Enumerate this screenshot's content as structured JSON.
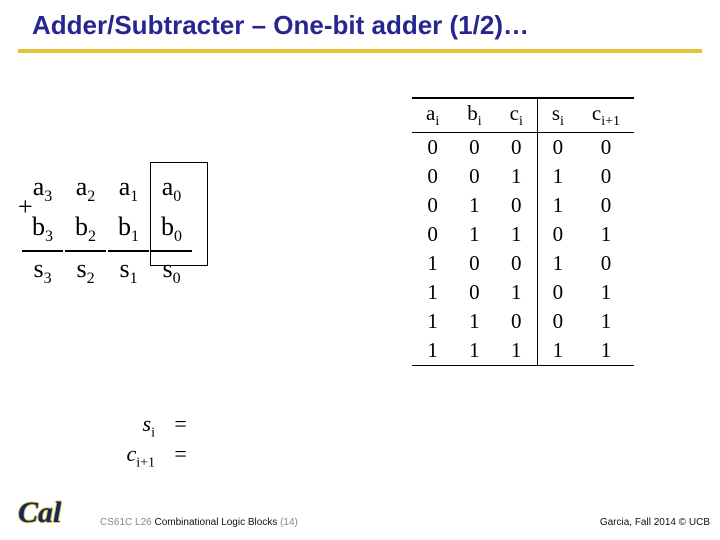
{
  "title": "Adder/Subtracter – One-bit adder (1/2)…",
  "addition": {
    "plus": "+",
    "row_a": [
      {
        "base": "a",
        "sub": "3"
      },
      {
        "base": "a",
        "sub": "2"
      },
      {
        "base": "a",
        "sub": "1"
      },
      {
        "base": "a",
        "sub": "0"
      }
    ],
    "row_b": [
      {
        "base": "b",
        "sub": "3"
      },
      {
        "base": "b",
        "sub": "2"
      },
      {
        "base": "b",
        "sub": "1"
      },
      {
        "base": "b",
        "sub": "0"
      }
    ],
    "row_s": [
      {
        "base": "s",
        "sub": "3"
      },
      {
        "base": "s",
        "sub": "2"
      },
      {
        "base": "s",
        "sub": "1"
      },
      {
        "base": "s",
        "sub": "0"
      }
    ]
  },
  "truth": {
    "headers": [
      {
        "base": "a",
        "sub": "i"
      },
      {
        "base": "b",
        "sub": "i"
      },
      {
        "base": "c",
        "sub": "i"
      },
      {
        "base": "s",
        "sub": "i"
      },
      {
        "base": "c",
        "sub": "i+1"
      }
    ],
    "rows": [
      [
        "0",
        "0",
        "0",
        "0",
        "0"
      ],
      [
        "0",
        "0",
        "1",
        "1",
        "0"
      ],
      [
        "0",
        "1",
        "0",
        "1",
        "0"
      ],
      [
        "0",
        "1",
        "1",
        "0",
        "1"
      ],
      [
        "1",
        "0",
        "0",
        "1",
        "0"
      ],
      [
        "1",
        "0",
        "1",
        "0",
        "1"
      ],
      [
        "1",
        "1",
        "0",
        "0",
        "1"
      ],
      [
        "1",
        "1",
        "1",
        "1",
        "1"
      ]
    ]
  },
  "eqns": {
    "s": {
      "base": "s",
      "sub": "i",
      "eq": "="
    },
    "c": {
      "base": "c",
      "sub": "i+1",
      "eq": "="
    }
  },
  "footer": {
    "cal": "Cal",
    "course": "CS61C L26 ",
    "lecture": "Combinational Logic Blocks",
    "page": " (14)",
    "right": "Garcia, Fall 2014 © UCB"
  }
}
